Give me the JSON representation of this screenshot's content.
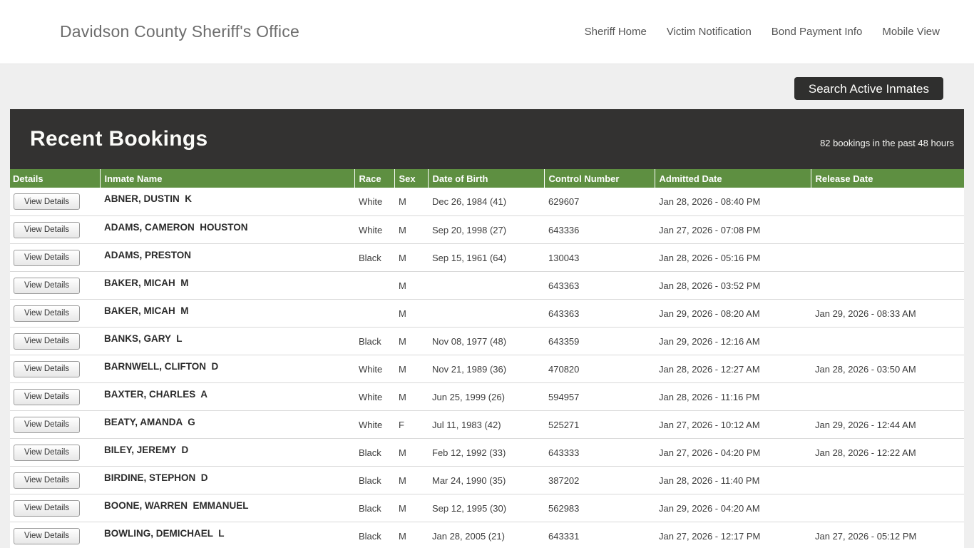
{
  "colors": {
    "accent_green": "#5e8f41",
    "header_dark": "#333231",
    "page_bg": "#efefef"
  },
  "topbar": {
    "brand": "Davidson County Sheriff's Office",
    "nav": [
      {
        "label": "Sheriff Home"
      },
      {
        "label": "Victim Notification"
      },
      {
        "label": "Bond Payment Info"
      },
      {
        "label": "Mobile View"
      }
    ]
  },
  "search": {
    "button_label": "Search Active Inmates"
  },
  "panel": {
    "title": "Recent Bookings",
    "caption": "82 bookings in the past 48 hours"
  },
  "table": {
    "columns": [
      "Details",
      "Inmate Name",
      "Race",
      "Sex",
      "Date of Birth",
      "Control Number",
      "Admitted Date",
      "Release Date"
    ],
    "view_details_label": "View Details",
    "rows": [
      {
        "name": "ABNER, DUSTIN  K",
        "race": "White",
        "sex": "M",
        "dob": "Dec 26, 1984 (41)",
        "control_number": "629607",
        "admitted": "Jan 28, 2026 - 08:40 PM",
        "released": ""
      },
      {
        "name": "ADAMS, CAMERON  HOUSTON",
        "race": "White",
        "sex": "M",
        "dob": "Sep 20, 1998 (27)",
        "control_number": "643336",
        "admitted": "Jan 27, 2026 - 07:08 PM",
        "released": ""
      },
      {
        "name": "ADAMS, PRESTON",
        "race": "Black",
        "sex": "M",
        "dob": "Sep 15, 1961 (64)",
        "control_number": "130043",
        "admitted": "Jan 28, 2026 - 05:16 PM",
        "released": ""
      },
      {
        "name": "BAKER, MICAH  M",
        "race": "",
        "sex": "M",
        "dob": "",
        "control_number": "643363",
        "admitted": "Jan 28, 2026 - 03:52 PM",
        "released": ""
      },
      {
        "name": "BAKER, MICAH  M",
        "race": "",
        "sex": "M",
        "dob": "",
        "control_number": "643363",
        "admitted": "Jan 29, 2026 - 08:20 AM",
        "released": "Jan 29, 2026 - 08:33 AM"
      },
      {
        "name": "BANKS, GARY  L",
        "race": "Black",
        "sex": "M",
        "dob": "Nov 08, 1977 (48)",
        "control_number": "643359",
        "admitted": "Jan 29, 2026 - 12:16 AM",
        "released": ""
      },
      {
        "name": "BARNWELL, CLIFTON  D",
        "race": "White",
        "sex": "M",
        "dob": "Nov 21, 1989 (36)",
        "control_number": "470820",
        "admitted": "Jan 28, 2026 - 12:27 AM",
        "released": "Jan 28, 2026 - 03:50 AM"
      },
      {
        "name": "BAXTER, CHARLES  A",
        "race": "White",
        "sex": "M",
        "dob": "Jun 25, 1999 (26)",
        "control_number": "594957",
        "admitted": "Jan 28, 2026 - 11:16 PM",
        "released": ""
      },
      {
        "name": "BEATY, AMANDA  G",
        "race": "White",
        "sex": "F",
        "dob": "Jul 11, 1983 (42)",
        "control_number": "525271",
        "admitted": "Jan 27, 2026 - 10:12 AM",
        "released": "Jan 29, 2026 - 12:44 AM"
      },
      {
        "name": "BILEY, JEREMY  D",
        "race": "Black",
        "sex": "M",
        "dob": "Feb 12, 1992 (33)",
        "control_number": "643333",
        "admitted": "Jan 27, 2026 - 04:20 PM",
        "released": "Jan 28, 2026 - 12:22 AM"
      },
      {
        "name": "BIRDINE, STEPHON  D",
        "race": "Black",
        "sex": "M",
        "dob": "Mar 24, 1990 (35)",
        "control_number": "387202",
        "admitted": "Jan 28, 2026 - 11:40 PM",
        "released": ""
      },
      {
        "name": "BOONE, WARREN  EMMANUEL",
        "race": "Black",
        "sex": "M",
        "dob": "Sep 12, 1995 (30)",
        "control_number": "562983",
        "admitted": "Jan 29, 2026 - 04:20 AM",
        "released": ""
      },
      {
        "name": "BOWLING, DEMICHAEL  L",
        "race": "Black",
        "sex": "M",
        "dob": "Jan 28, 2005 (21)",
        "control_number": "643331",
        "admitted": "Jan 27, 2026 - 12:17 PM",
        "released": "Jan 27, 2026 - 05:12 PM"
      }
    ]
  }
}
